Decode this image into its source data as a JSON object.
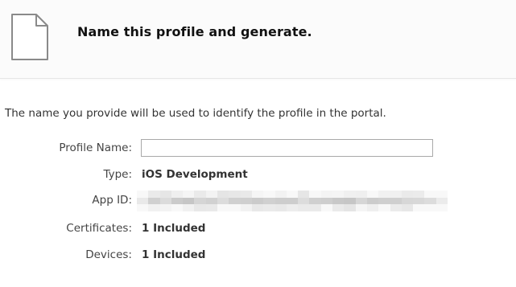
{
  "header": {
    "title": "Name this profile and generate.",
    "icon": "document-icon"
  },
  "intro_text": "The name you provide will be used to identify the profile in the portal.",
  "form": {
    "profile_name": {
      "label": "Profile Name:",
      "value": "",
      "placeholder": ""
    },
    "type": {
      "label": "Type:",
      "value": "iOS Development"
    },
    "app_id": {
      "label": "App ID:",
      "value_redacted": true
    },
    "certificates": {
      "label": "Certificates:",
      "value": "1 Included"
    },
    "devices": {
      "label": "Devices:",
      "value": "1 Included"
    }
  },
  "colors": {
    "header_bg": "#fbfbfb",
    "text": "#333333",
    "input_border": "#a9a9a9"
  }
}
